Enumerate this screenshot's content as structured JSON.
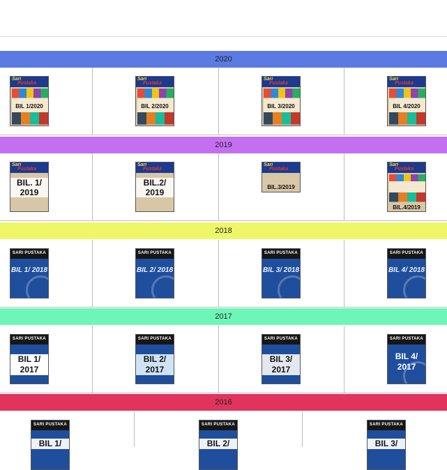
{
  "sections": [
    {
      "year": "2020",
      "color": "#5b7be3",
      "issues": [
        {
          "label": "BIL 1/2020",
          "brand": "Sari Pustaka"
        },
        {
          "label": "BIL 2/2020",
          "brand": "Sari Pustaka"
        },
        {
          "label": "BIL 3/2020",
          "brand": "Sari Pustaka"
        },
        {
          "label": "BIL 4/2020",
          "brand": "Sari Pustaka"
        }
      ]
    },
    {
      "year": "2019",
      "color": "#c46ff2",
      "issues": [
        {
          "label": "BIL. 1/ 2019",
          "brand": "Sari Pustaka"
        },
        {
          "label": "BIL.2/ 2019",
          "brand": "Sari Pustaka"
        },
        {
          "label": "BIL.3/2019",
          "brand": "Sari Pustaka"
        },
        {
          "label": "BIL.4/2019",
          "brand": "Sari Pustaka"
        }
      ]
    },
    {
      "year": "2018",
      "color": "#eef76a",
      "issues": [
        {
          "label": "BIL 1/ 2018",
          "brand": "SARI PUSTAKA"
        },
        {
          "label": "BIL 2/ 2018",
          "brand": "SARI PUSTAKA"
        },
        {
          "label": "BIL 3/ 2018",
          "brand": "SARI PUSTAKA"
        },
        {
          "label": "BIL 4/ 2018",
          "brand": "SARI PUSTAKA"
        }
      ]
    },
    {
      "year": "2017",
      "color": "#6ef6b8",
      "issues": [
        {
          "label": "BIL 1/ 2017",
          "brand": "SARI PUSTAKA"
        },
        {
          "label": "BIL 2/ 2017",
          "brand": "SARI PUSTAKA"
        },
        {
          "label": "BIL 3/ 2017",
          "brand": "SARI PUSTAKA"
        },
        {
          "label": "BIL 4/ 2017",
          "brand": "SARI PUSTAKA"
        }
      ]
    },
    {
      "year": "2016",
      "color": "#e0345e",
      "issues": [
        {
          "label": "BIL 1/",
          "brand": "SARI PUSTAKA"
        },
        {
          "label": "BIL 2/",
          "brand": "SARI PUSTAKA"
        },
        {
          "label": "BIL 3/",
          "brand": "SARI PUSTAKA"
        }
      ]
    }
  ]
}
